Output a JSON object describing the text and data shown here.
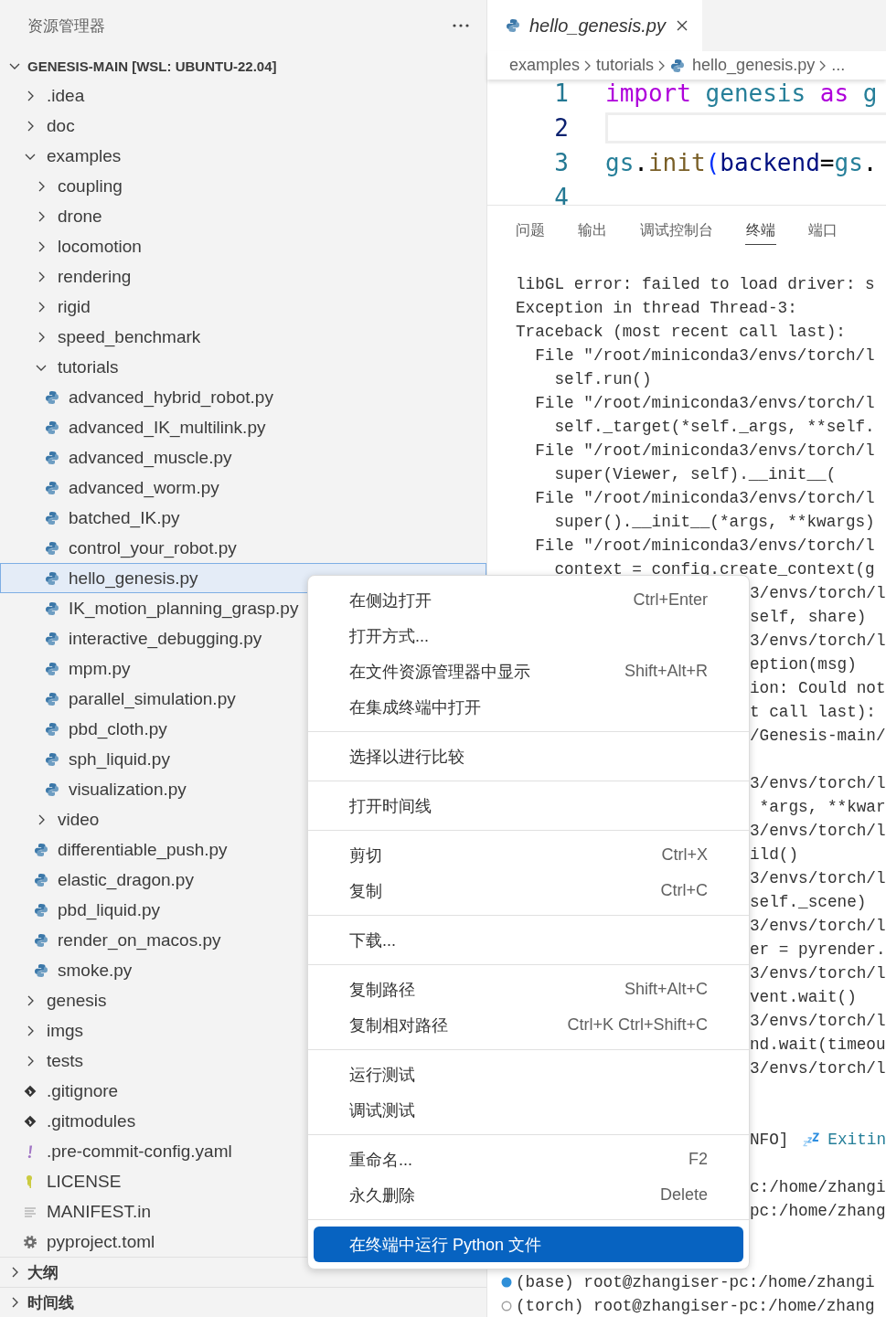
{
  "sidebar": {
    "title": "资源管理器",
    "section": {
      "title": "GENESIS-MAIN [WSL: UBUNTU-22.04]",
      "expanded": true
    },
    "tree": [
      {
        "label": ".idea",
        "kind": "folder",
        "expanded": false,
        "selected": false
      },
      {
        "label": "doc",
        "kind": "folder",
        "expanded": false,
        "selected": false
      },
      {
        "label": "examples",
        "kind": "folder",
        "expanded": true,
        "selected": false,
        "children": [
          {
            "label": "coupling",
            "kind": "folder",
            "expanded": false,
            "selected": false
          },
          {
            "label": "drone",
            "kind": "folder",
            "expanded": false,
            "selected": false
          },
          {
            "label": "locomotion",
            "kind": "folder",
            "expanded": false,
            "selected": false
          },
          {
            "label": "rendering",
            "kind": "folder",
            "expanded": false,
            "selected": false
          },
          {
            "label": "rigid",
            "kind": "folder",
            "expanded": false,
            "selected": false
          },
          {
            "label": "speed_benchmark",
            "kind": "folder",
            "expanded": false,
            "selected": false
          },
          {
            "label": "tutorials",
            "kind": "folder",
            "expanded": true,
            "selected": false,
            "children": [
              {
                "label": "advanced_hybrid_robot.py",
                "kind": "python",
                "selected": false
              },
              {
                "label": "advanced_IK_multilink.py",
                "kind": "python",
                "selected": false
              },
              {
                "label": "advanced_muscle.py",
                "kind": "python",
                "selected": false
              },
              {
                "label": "advanced_worm.py",
                "kind": "python",
                "selected": false
              },
              {
                "label": "batched_IK.py",
                "kind": "python",
                "selected": false
              },
              {
                "label": "control_your_robot.py",
                "kind": "python",
                "selected": false
              },
              {
                "label": "hello_genesis.py",
                "kind": "python",
                "selected": true
              },
              {
                "label": "IK_motion_planning_grasp.py",
                "kind": "python",
                "selected": false
              },
              {
                "label": "interactive_debugging.py",
                "kind": "python",
                "selected": false
              },
              {
                "label": "mpm.py",
                "kind": "python",
                "selected": false
              },
              {
                "label": "parallel_simulation.py",
                "kind": "python",
                "selected": false
              },
              {
                "label": "pbd_cloth.py",
                "kind": "python",
                "selected": false
              },
              {
                "label": "sph_liquid.py",
                "kind": "python",
                "selected": false
              },
              {
                "label": "visualization.py",
                "kind": "python",
                "selected": false
              }
            ]
          },
          {
            "label": "video",
            "kind": "folder",
            "expanded": false,
            "selected": false
          },
          {
            "label": "differentiable_push.py",
            "kind": "python",
            "selected": false
          },
          {
            "label": "elastic_dragon.py",
            "kind": "python",
            "selected": false
          },
          {
            "label": "pbd_liquid.py",
            "kind": "python",
            "selected": false
          },
          {
            "label": "render_on_macos.py",
            "kind": "python",
            "selected": false
          },
          {
            "label": "smoke.py",
            "kind": "python",
            "selected": false
          }
        ]
      },
      {
        "label": "genesis",
        "kind": "folder",
        "expanded": false,
        "selected": false
      },
      {
        "label": "imgs",
        "kind": "folder",
        "expanded": false,
        "selected": false
      },
      {
        "label": "tests",
        "kind": "folder",
        "expanded": false,
        "selected": false
      },
      {
        "label": ".gitignore",
        "kind": "git",
        "selected": false
      },
      {
        "label": ".gitmodules",
        "kind": "git",
        "selected": false
      },
      {
        "label": ".pre-commit-config.yaml",
        "kind": "yaml",
        "selected": false
      },
      {
        "label": "LICENSE",
        "kind": "license",
        "selected": false
      },
      {
        "label": "MANIFEST.in",
        "kind": "text",
        "selected": false
      },
      {
        "label": "pyproject.toml",
        "kind": "config",
        "selected": false
      }
    ],
    "bottom_sections": [
      {
        "title": "大纲",
        "expanded": false
      },
      {
        "title": "时间线",
        "expanded": false
      }
    ]
  },
  "editor": {
    "tab": {
      "title": "hello_genesis.py",
      "selected": true
    },
    "breadcrumbs": [
      "examples",
      "tutorials",
      "hello_genesis.py",
      "..."
    ],
    "lines": [
      {
        "number": "1",
        "current": false,
        "tokens": [
          {
            "kind": "keyword",
            "text": "import "
          },
          {
            "kind": "module",
            "text": "genesis "
          },
          {
            "kind": "keyword",
            "text": "as "
          },
          {
            "kind": "module",
            "text": "g"
          }
        ]
      },
      {
        "number": "2",
        "current": true
      },
      {
        "number": "3",
        "current": false,
        "tokens": [
          {
            "kind": "module",
            "text": "gs"
          },
          {
            "kind": "plain",
            "text": "."
          },
          {
            "kind": "func",
            "text": "init"
          },
          {
            "kind": "bracket",
            "text": "("
          },
          {
            "kind": "param",
            "text": "backend"
          },
          {
            "kind": "plain",
            "text": "="
          },
          {
            "kind": "module",
            "text": "gs"
          },
          {
            "kind": "plain",
            "text": "."
          }
        ]
      },
      {
        "number": "4",
        "current": false
      }
    ]
  },
  "panel": {
    "tabs": [
      {
        "label": "问题",
        "selected": false
      },
      {
        "label": "输出",
        "selected": false
      },
      {
        "label": "调试控制台",
        "selected": false
      },
      {
        "label": "终端",
        "selected": true
      },
      {
        "label": "端口",
        "selected": false
      }
    ],
    "terminal": [
      {
        "kind": "text",
        "text": "libGL error: failed to load driver: s"
      },
      {
        "kind": "text",
        "text": "Exception in thread Thread-3:"
      },
      {
        "kind": "text",
        "text": "Traceback (most recent call last):"
      },
      {
        "kind": "text",
        "text": "  File \"/root/miniconda3/envs/torch/l"
      },
      {
        "kind": "text",
        "text": "    self.run()"
      },
      {
        "kind": "text",
        "text": "  File \"/root/miniconda3/envs/torch/l"
      },
      {
        "kind": "text",
        "text": "    self._target(*self._args, **self."
      },
      {
        "kind": "text",
        "text": "  File \"/root/miniconda3/envs/torch/l"
      },
      {
        "kind": "text",
        "text": "    super(Viewer, self).__init__("
      },
      {
        "kind": "text",
        "text": "  File \"/root/miniconda3/envs/torch/l"
      },
      {
        "kind": "text",
        "text": "    super().__init__(*args, **kwargs)"
      },
      {
        "kind": "text",
        "text": "  File \"/root/miniconda3/envs/torch/l"
      },
      {
        "kind": "text",
        "text": "    context = config.create_context(g"
      },
      {
        "kind": "covered",
        "text": "3/envs/torch/l"
      },
      {
        "kind": "covered",
        "text": "self, share)"
      },
      {
        "kind": "covered",
        "text": "3/envs/torch/l"
      },
      {
        "kind": "covered",
        "text": "eption(msg)"
      },
      {
        "kind": "covered",
        "text": "ion: Could not"
      },
      {
        "kind": "covered",
        "text": "t call last):"
      },
      {
        "kind": "covered",
        "text": "/Genesis-main/"
      },
      {
        "kind": "blank"
      },
      {
        "kind": "covered",
        "text": "3/envs/torch/l"
      },
      {
        "kind": "covered",
        "text": " *args, **kwar"
      },
      {
        "kind": "covered",
        "text": "3/envs/torch/l"
      },
      {
        "kind": "covered",
        "text": "ild()"
      },
      {
        "kind": "covered",
        "text": "3/envs/torch/l"
      },
      {
        "kind": "covered",
        "text": "self._scene)"
      },
      {
        "kind": "covered",
        "text": "3/envs/torch/l"
      },
      {
        "kind": "covered",
        "text": "er = pyrender."
      },
      {
        "kind": "covered",
        "text": "3/envs/torch/l"
      },
      {
        "kind": "covered",
        "text": "vent.wait()"
      },
      {
        "kind": "covered",
        "text": "3/envs/torch/l"
      },
      {
        "kind": "covered",
        "text": "nd.wait(timeou"
      },
      {
        "kind": "covered",
        "text": "3/envs/torch/l"
      },
      {
        "kind": "blank"
      },
      {
        "kind": "blank"
      },
      {
        "kind": "info",
        "text": "NFO]",
        "message": "Exitin"
      },
      {
        "kind": "blank"
      },
      {
        "kind": "covered",
        "text": "c:/home/zhangi"
      },
      {
        "kind": "covered",
        "text": "pc:/home/zhang"
      },
      {
        "kind": "blank"
      },
      {
        "kind": "blank"
      },
      {
        "kind": "prompt",
        "active": true,
        "text": "(base) root@zhangiser-pc:/home/zhangi"
      },
      {
        "kind": "prompt",
        "active": false,
        "text": "(torch) root@zhangiser-pc:/home/zhang"
      }
    ]
  },
  "context_menu": {
    "groups": [
      {
        "items": [
          {
            "label": "在侧边打开",
            "shortcut": "Ctrl+Enter",
            "selected": false
          },
          {
            "label": "打开方式...",
            "selected": false
          },
          {
            "label": "在文件资源管理器中显示",
            "shortcut": "Shift+Alt+R",
            "selected": false
          },
          {
            "label": "在集成终端中打开",
            "selected": false
          }
        ]
      },
      {
        "items": [
          {
            "label": "选择以进行比较",
            "selected": false
          }
        ]
      },
      {
        "items": [
          {
            "label": "打开时间线",
            "selected": false
          }
        ]
      },
      {
        "items": [
          {
            "label": "剪切",
            "shortcut": "Ctrl+X",
            "selected": false
          },
          {
            "label": "复制",
            "shortcut": "Ctrl+C",
            "selected": false
          }
        ]
      },
      {
        "items": [
          {
            "label": "下载...",
            "selected": false
          }
        ]
      },
      {
        "items": [
          {
            "label": "复制路径",
            "shortcut": "Shift+Alt+C",
            "selected": false
          },
          {
            "label": "复制相对路径",
            "shortcut": "Ctrl+K Ctrl+Shift+C",
            "selected": false
          }
        ]
      },
      {
        "items": [
          {
            "label": "运行测试",
            "selected": false
          },
          {
            "label": "调试测试",
            "selected": false
          }
        ]
      },
      {
        "items": [
          {
            "label": "重命名...",
            "shortcut": "F2",
            "selected": false
          },
          {
            "label": "永久删除",
            "shortcut": "Delete",
            "selected": false
          }
        ]
      },
      {
        "items": [
          {
            "label": "在终端中运行 Python 文件",
            "selected": true
          }
        ]
      }
    ]
  }
}
